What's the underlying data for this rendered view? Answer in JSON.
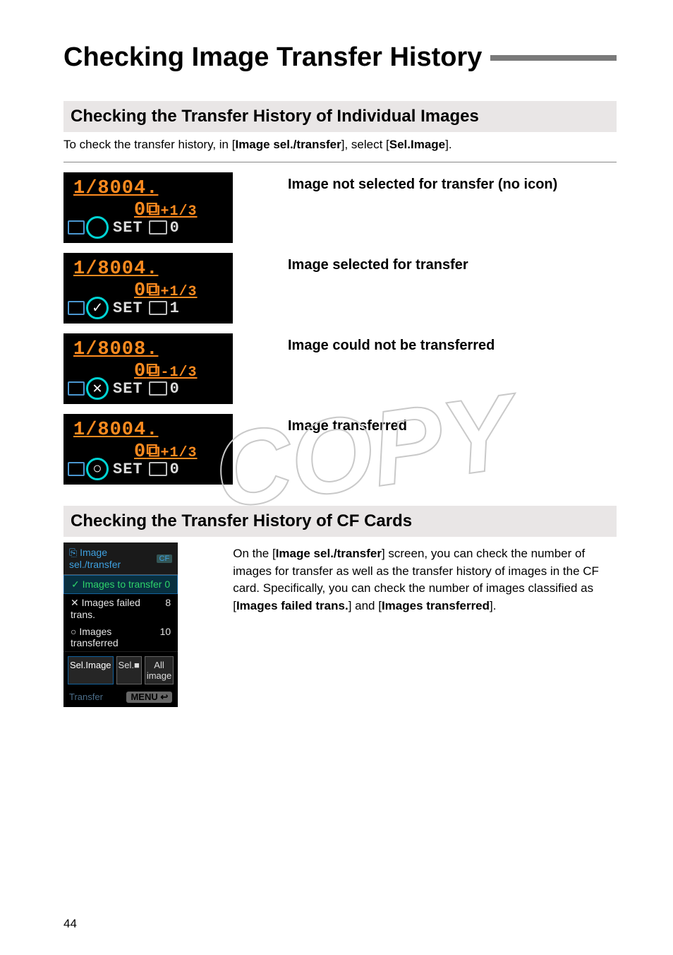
{
  "page_number": "44",
  "h1": "Checking Image Transfer History",
  "section1": {
    "heading": "Checking the Transfer History of Individual Images",
    "instr_pre": "To check the transfer history, in [",
    "instr_b1": "Image sel./transfer",
    "instr_mid": "], select [",
    "instr_b2": "Sel.Image",
    "instr_post": "]."
  },
  "states": [
    {
      "label": "Image not selected for transfer (no icon)",
      "shutter": "1/800",
      "aperture_main": "4. 0",
      "aperture_frac": "+1/3",
      "icon": "",
      "set": "SET",
      "count": "0"
    },
    {
      "label": "Image selected for transfer",
      "shutter": "1/800",
      "aperture_main": "4. 0",
      "aperture_frac": "+1/3",
      "icon": "✓",
      "set": "SET",
      "count": "1"
    },
    {
      "label": "Image could not be transferred",
      "shutter": "1/800",
      "aperture_main": "8. 0",
      "aperture_frac": "-1/3",
      "icon": "✕",
      "set": "SET",
      "count": "0"
    },
    {
      "label": "Image transferred",
      "shutter": "1/800",
      "aperture_main": "4. 0",
      "aperture_frac": "+1/3",
      "icon": "○",
      "set": "SET",
      "count": "0"
    }
  ],
  "section2": {
    "heading": "Checking the Transfer History of CF Cards",
    "menu_title": "Image sel./transfer",
    "cf_badge": "CF",
    "rows": [
      {
        "sym": "✓",
        "label": "Images to transfer",
        "val": "0"
      },
      {
        "sym": "✕",
        "label": "Images failed trans.",
        "val": "8"
      },
      {
        "sym": "○",
        "label": "Images transferred",
        "val": "10"
      }
    ],
    "tabs": [
      "Sel.Image",
      "Sel.■",
      "All image"
    ],
    "foot_left": "Transfer",
    "foot_right": "MENU ↩",
    "para_1a": "On the [",
    "para_1b": "Image sel./transfer",
    "para_1c": "] screen, you can check the number of images for transfer as well as the transfer history of images in the CF card. Specifically, you can check the number of images classified as [",
    "para_1d": "Images failed trans.",
    "para_1e": "] and [",
    "para_1f": "Images transferred",
    "para_1g": "]."
  },
  "watermark": "COPY"
}
